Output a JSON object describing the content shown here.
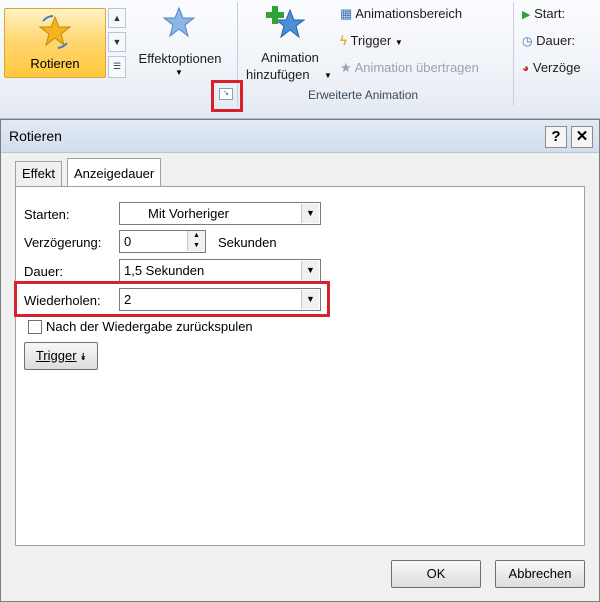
{
  "ribbon": {
    "rotieren_label": "Rotieren",
    "effektoptionen_label": "Effektoptionen",
    "animation_hinzufuegen_line1": "Animation",
    "animation_hinzufuegen_line2": "hinzufügen",
    "animationsbereich_label": "Animationsbereich",
    "trigger_label": "Trigger",
    "animation_uebertragen_label": "Animation übertragen",
    "group_label": "Erweiterte Animation",
    "start_label": "Start:",
    "dauer_label": "Dauer:",
    "verzoegerung_label": "Verzöge"
  },
  "dialog": {
    "title": "Rotieren",
    "help_label": "?",
    "close_label": "✕",
    "tabs": [
      {
        "label": "Effekt",
        "active": false
      },
      {
        "label": "Anzeigedauer",
        "active": true
      }
    ],
    "starten_label": "Starten:",
    "starten_value": "Mit Vorheriger",
    "verzoegerung_label": "Verzögerung:",
    "verzoegerung_value": "0",
    "verzoegerung_unit": "Sekunden",
    "dauer_label": "Dauer:",
    "dauer_value": "1,5 Sekunden",
    "wiederholen_label": "Wiederholen:",
    "wiederholen_value": "2",
    "zurueckspulen_label": "Nach der Wiedergabe zurückspulen",
    "zurueckspulen_checked": false,
    "trigger_button_label": "Trigger",
    "ok_label": "OK",
    "abbrechen_label": "Abbrechen"
  },
  "colors": {
    "highlight_red": "#d6222e",
    "selected_gold": "#ffd774"
  }
}
